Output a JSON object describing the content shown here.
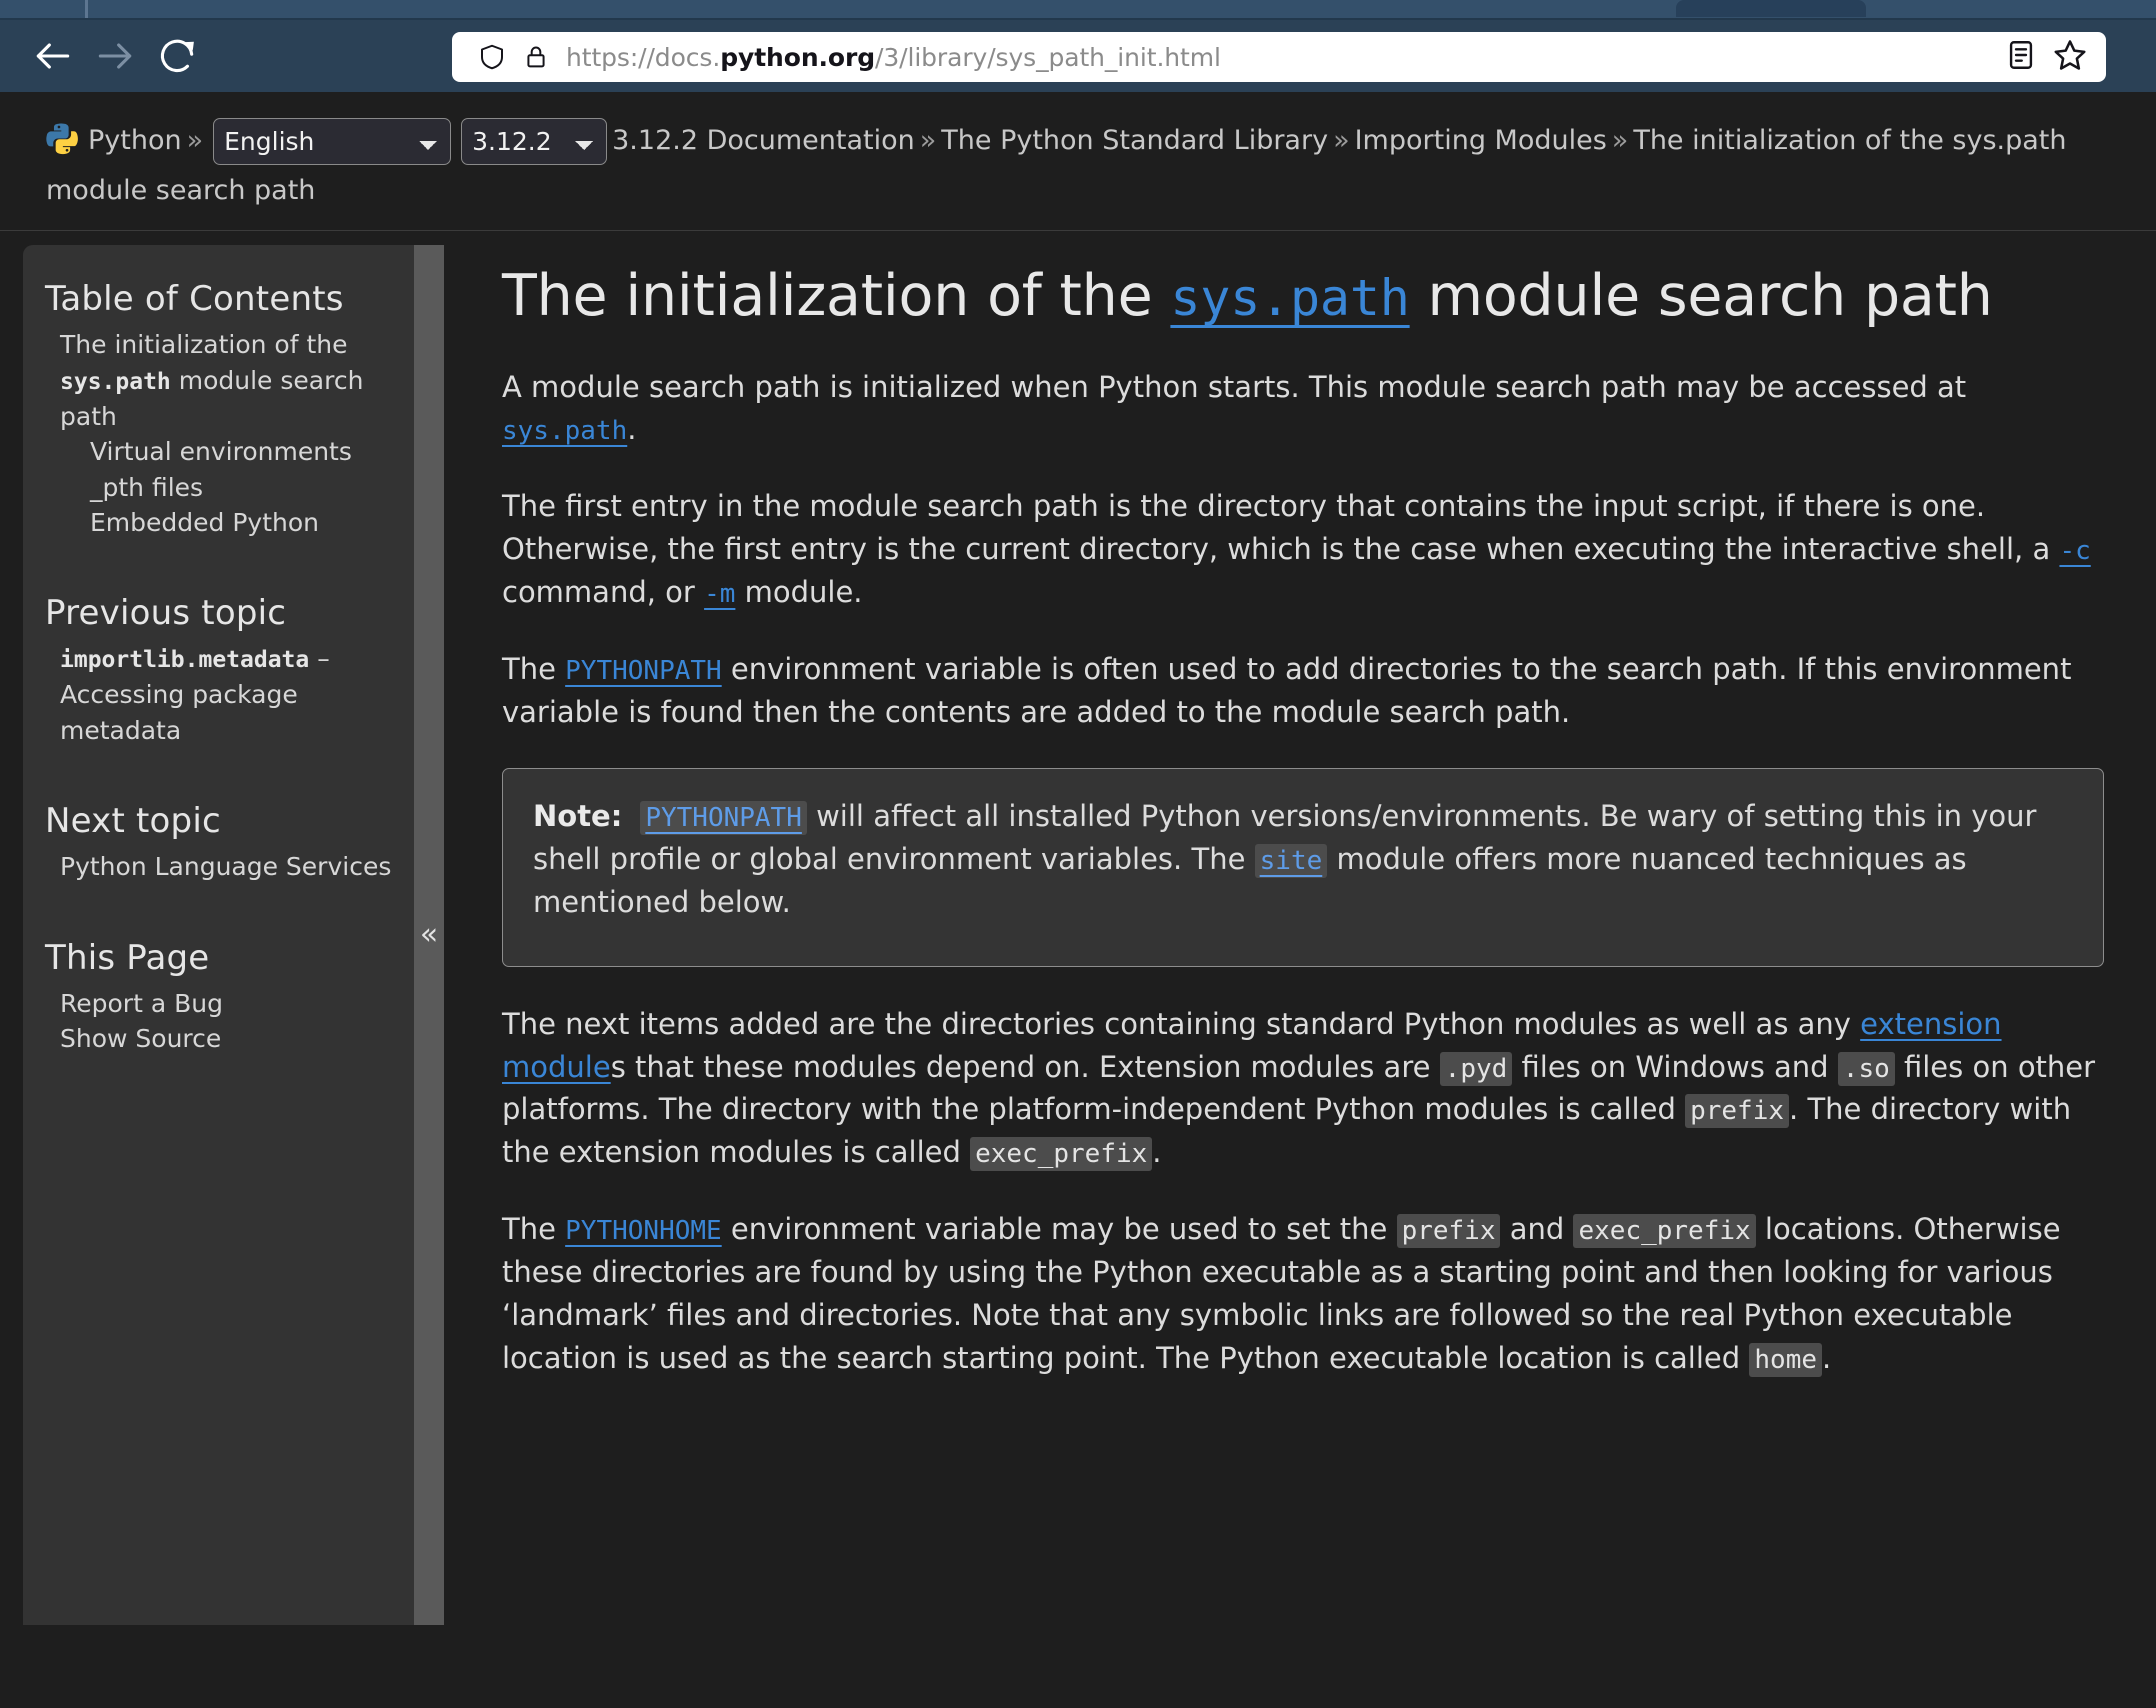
{
  "browser": {
    "url_prefix": "https://docs.",
    "url_domain": "python.org",
    "url_path": "/3/library/sys_path_init.html",
    "url_full": "https://docs.python.org/3/library/sys_path_init.html",
    "back_label": "Back",
    "forward_label": "Forward",
    "reload_label": "Reload",
    "shield_label": "Tracking protection",
    "lock_label": "Connection secure",
    "reader_label": "Reader view",
    "bookmark_label": "Bookmark this page"
  },
  "breadcrumb": {
    "logo": "python-logo",
    "home": "Python",
    "sep": "»",
    "language_selected": "English",
    "language_options": [
      "English"
    ],
    "version_selected": "3.12.2",
    "version_options": [
      "3.12.2"
    ],
    "items": [
      "3.12.2 Documentation",
      "The Python Standard Library",
      "Importing Modules",
      "The initialization of the sys.path module search path"
    ],
    "trailing_wrap": "search path"
  },
  "sidebar": {
    "toc_heading": "Table of Contents",
    "toc_root_pre": "The initialization of the ",
    "toc_root_code": "sys.path",
    "toc_root_post": " module search path",
    "toc_children": [
      "Virtual environments",
      "_pth files",
      "Embedded Python"
    ],
    "prev_heading": "Previous topic",
    "prev_code": "importlib.metadata",
    "prev_rest": " – Accessing package metadata",
    "next_heading": "Next topic",
    "next_link": "Python Language Services",
    "thispage_heading": "This Page",
    "thispage_links": [
      "Report a Bug",
      "Show Source"
    ],
    "collapse_glyph": "«",
    "collapse_label": "Collapse sidebar"
  },
  "content": {
    "title_pre": "The initialization of the ",
    "title_code": "sys.path",
    "title_post": " module search path",
    "p1_a": "A module search path is initialized when Python starts. This module search path may be accessed at ",
    "p1_code": "sys.path",
    "p1_b": ".",
    "p2_a": "The first entry in the module search path is the directory that contains the input script, if there is one. Otherwise, the first entry is the current directory, which is the case when executing the interactive shell, a ",
    "p2_opt1": "-c",
    "p2_b": " command, or ",
    "p2_opt2": "-m",
    "p2_c": " module.",
    "p3_a": "The ",
    "p3_code": "PYTHONPATH",
    "p3_b": " environment variable is often used to add directories to the search path. If this environment variable is found then the contents are added to the module search path.",
    "note_label": "Note:",
    "note_code1": "PYTHONPATH",
    "note_a": " will affect all installed Python versions/environments. Be wary of setting this in your shell profile or global environment variables. The ",
    "note_code2": "site",
    "note_b": " module offers more nuanced techniques as mentioned below.",
    "p4_a": "The next items added are the directories containing standard Python modules as well as any ",
    "p4_link": "extension module",
    "p4_b": "s that these modules depend on. Extension modules are ",
    "p4_c1": ".pyd",
    "p4_c": " files on Windows and ",
    "p4_c2": ".so",
    "p4_d": " files on other platforms. The directory with the platform-independent Python modules is called ",
    "p4_c3": "prefix",
    "p4_e": ". The directory with the extension modules is called ",
    "p4_c4": "exec_prefix",
    "p4_f": ".",
    "p5_a": "The ",
    "p5_code": "PYTHONHOME",
    "p5_b": " environment variable may be used to set the ",
    "p5_c1": "prefix",
    "p5_c": " and ",
    "p5_c2": "exec_prefix",
    "p5_d": " locations. Otherwise these directories are found by using the Python executable as a starting point and then looking for various ‘landmark’ files and directories. Note that any symbolic links are followed so the real Python executable location is used as the search starting point. The Python executable location is called ",
    "p5_c3": "home",
    "p5_e": "."
  },
  "colors": {
    "chrome": "#2b4156",
    "page_bg": "#1e1e1e",
    "sidebar_bg": "#333333",
    "link": "#3a86d6",
    "code_bg": "#4c4c4c",
    "text": "#dcdcdc"
  }
}
